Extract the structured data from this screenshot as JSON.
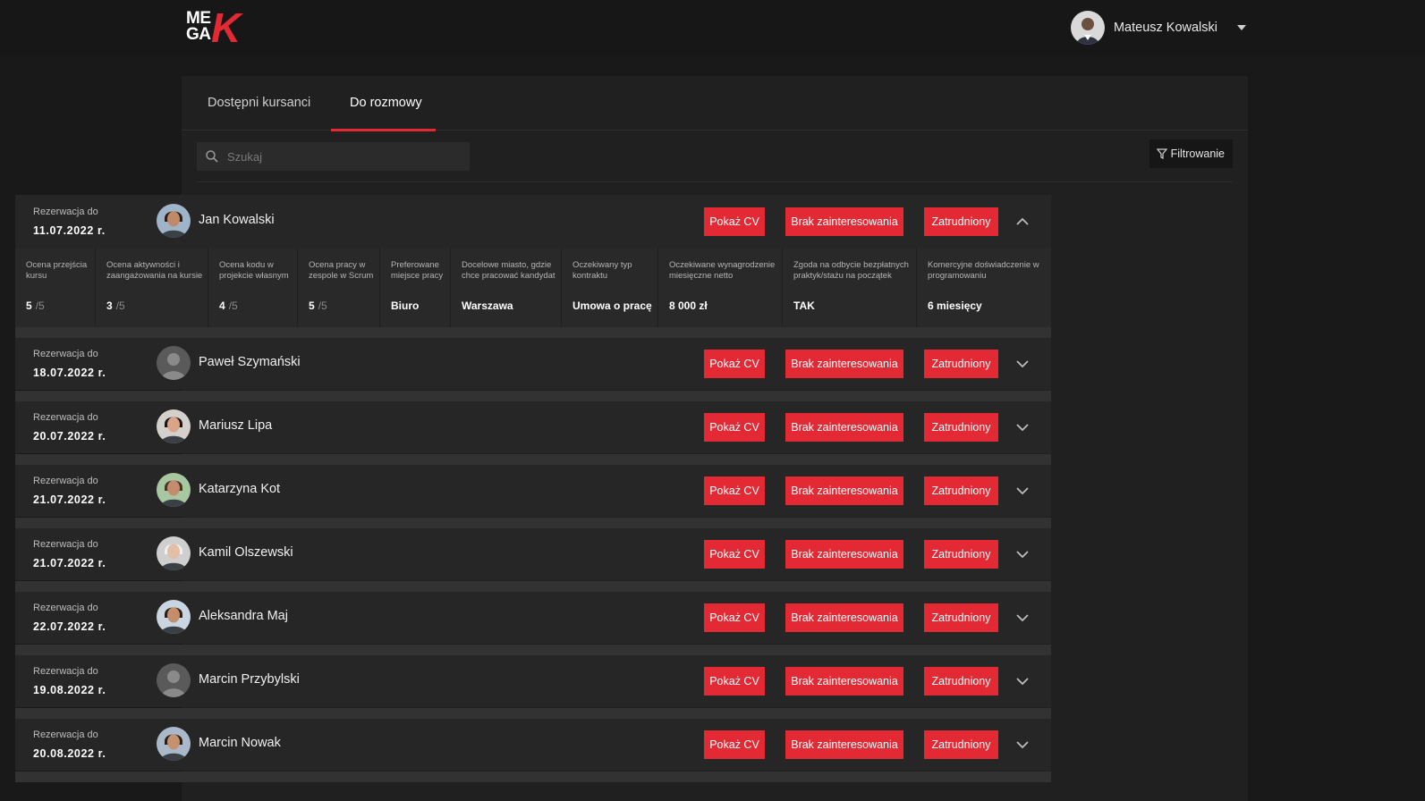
{
  "header": {
    "logo_text": "MEGAK",
    "logo_line1": "ME",
    "logo_line2": "GA",
    "logo_k": "K",
    "user_name": "Mateusz Kowalski"
  },
  "tabs": [
    {
      "label": "Dostępni kursanci",
      "active": false
    },
    {
      "label": "Do rozmowy",
      "active": true
    }
  ],
  "search": {
    "placeholder": "Szukaj"
  },
  "filter": {
    "label": "Filtrowanie"
  },
  "row_labels": {
    "reservation": "Rezerwacja do",
    "show_cv": "Pokaż CV",
    "no_interest": "Brak zainteresowania",
    "hired": "Zatrudniony"
  },
  "candidates": [
    {
      "date": "11.07.2022 r.",
      "name": "Jan Kowalski",
      "expanded": true,
      "avatar": "photo"
    },
    {
      "date": "18.07.2022 r.",
      "name": "Paweł Szymański",
      "expanded": false,
      "avatar": "placeholder"
    },
    {
      "date": "20.07.2022 r.",
      "name": "Mariusz Lipa",
      "expanded": false,
      "avatar": "photo"
    },
    {
      "date": "21.07.2022 r.",
      "name": "Katarzyna Kot",
      "expanded": false,
      "avatar": "photo"
    },
    {
      "date": "21.07.2022 r.",
      "name": "Kamil Olszewski",
      "expanded": false,
      "avatar": "photo"
    },
    {
      "date": "22.07.2022 r.",
      "name": "Aleksandra Maj",
      "expanded": false,
      "avatar": "photo"
    },
    {
      "date": "19.08.2022 r.",
      "name": "Marcin Przybylski",
      "expanded": false,
      "avatar": "placeholder"
    },
    {
      "date": "20.08.2022 r.",
      "name": "Marcin Nowak",
      "expanded": false,
      "avatar": "photo"
    }
  ],
  "details": [
    {
      "header": "Ocena przejścia kursu",
      "value": "5",
      "denominator": "/5"
    },
    {
      "header": "Ocena aktywności i zaangażowania na kursie",
      "value": "3",
      "denominator": "/5"
    },
    {
      "header": "Ocena kodu w projekcie własnym",
      "value": "4",
      "denominator": "/5"
    },
    {
      "header": "Ocena pracy w zespole w Scrum",
      "value": "5",
      "denominator": "/5"
    },
    {
      "header": "Preferowane miejsce pracy",
      "value": "Biuro"
    },
    {
      "header": "Docelowe miasto, gdzie chce pracować kandydat",
      "value": "Warszawa"
    },
    {
      "header": "Oczekiwany typ kontraktu",
      "value": "Umowa o pracę"
    },
    {
      "header": "Oczekiwane wynagrodzenie miesięczne netto",
      "value": "8 000 zł"
    },
    {
      "header": "Zgoda na odbycie bezpłatnych praktyk/stażu na początek",
      "value": "TAK"
    },
    {
      "header": "Komercyjne doświadczenie w programowaniu",
      "value": "6 miesięcy"
    }
  ],
  "colors": {
    "accent": "#e32934",
    "background": "#191919",
    "panel": "#202020",
    "row": "#262626"
  }
}
